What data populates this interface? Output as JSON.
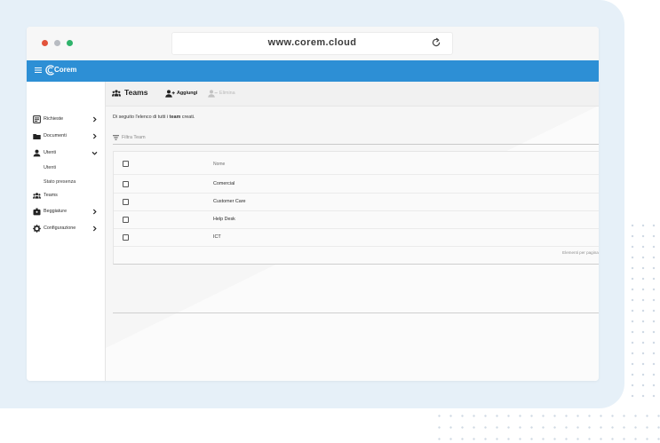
{
  "browser": {
    "url": "www.corem.cloud",
    "traffic_light_colors": [
      "#e2533b",
      "#b8bcc2",
      "#2fb36b"
    ]
  },
  "app": {
    "logo_text": "Corem",
    "brand_color": "#2d8fd5"
  },
  "sidebar": {
    "items": [
      {
        "label": "Richieste",
        "icon": "requests-icon",
        "chevron": "right"
      },
      {
        "label": "Documenti",
        "icon": "folder-icon",
        "chevron": "right"
      },
      {
        "label": "Utenti",
        "icon": "user-icon",
        "chevron": "down"
      },
      {
        "label": "Utenti",
        "icon": "",
        "sub": true
      },
      {
        "label": "Stato presenza",
        "icon": "",
        "sub": true
      },
      {
        "label": "Teams",
        "icon": "teams-icon",
        "chevron": ""
      },
      {
        "label": "Beggiature",
        "icon": "badge-icon",
        "chevron": "right"
      },
      {
        "label": "Configurazione",
        "icon": "gear-icon",
        "chevron": "right"
      }
    ]
  },
  "toolbar": {
    "title": "Teams",
    "add_label": "Aggiungi",
    "delete_label": "Elimina"
  },
  "main": {
    "intro_prefix": "Di seguito l'elenco di tutti i ",
    "intro_bold": "team",
    "intro_suffix": " creati.",
    "filter_placeholder": "Filtra Team"
  },
  "table": {
    "column_name": "Nome",
    "rows": [
      "Comercial",
      "Customer Care",
      "Help Desk",
      "ICT"
    ],
    "footer": "Elementi per pagina"
  }
}
